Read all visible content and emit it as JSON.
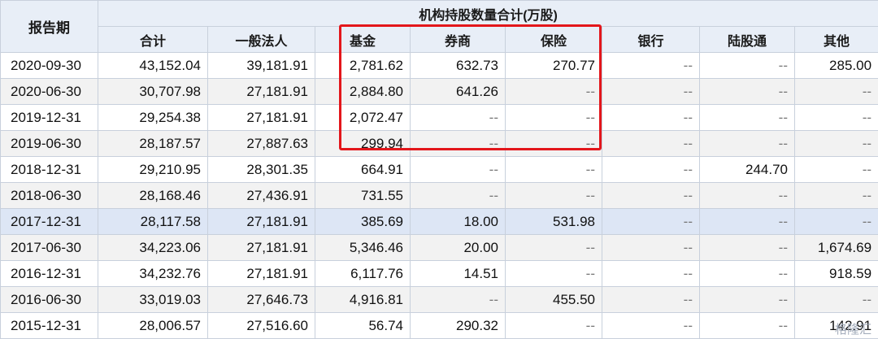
{
  "header": {
    "date_col": "报告期",
    "group_title": "机构持股数量合计(万股)",
    "columns": [
      "合计",
      "一般法人",
      "基金",
      "券商",
      "保险",
      "银行",
      "陆股通",
      "其他"
    ]
  },
  "rows": [
    {
      "date": "2020-09-30",
      "cells": [
        "43,152.04",
        "39,181.91",
        "2,781.62",
        "632.73",
        "270.77",
        "--",
        "--",
        "285.00"
      ]
    },
    {
      "date": "2020-06-30",
      "cells": [
        "30,707.98",
        "27,181.91",
        "2,884.80",
        "641.26",
        "--",
        "--",
        "--",
        "--"
      ]
    },
    {
      "date": "2019-12-31",
      "cells": [
        "29,254.38",
        "27,181.91",
        "2,072.47",
        "--",
        "--",
        "--",
        "--",
        "--"
      ]
    },
    {
      "date": "2019-06-30",
      "cells": [
        "28,187.57",
        "27,887.63",
        "299.94",
        "--",
        "--",
        "--",
        "--",
        "--"
      ]
    },
    {
      "date": "2018-12-31",
      "cells": [
        "29,210.95",
        "28,301.35",
        "664.91",
        "--",
        "--",
        "--",
        "244.70",
        "--"
      ]
    },
    {
      "date": "2018-06-30",
      "cells": [
        "28,168.46",
        "27,436.91",
        "731.55",
        "--",
        "--",
        "--",
        "--",
        "--"
      ]
    },
    {
      "date": "2017-12-31",
      "cells": [
        "28,117.58",
        "27,181.91",
        "385.69",
        "18.00",
        "531.98",
        "--",
        "--",
        "--"
      ]
    },
    {
      "date": "2017-06-30",
      "cells": [
        "34,223.06",
        "27,181.91",
        "5,346.46",
        "20.00",
        "--",
        "--",
        "--",
        "1,674.69"
      ]
    },
    {
      "date": "2016-12-31",
      "cells": [
        "34,232.76",
        "27,181.91",
        "6,117.76",
        "14.51",
        "--",
        "--",
        "--",
        "918.59"
      ]
    },
    {
      "date": "2016-06-30",
      "cells": [
        "33,019.03",
        "27,646.73",
        "4,916.81",
        "--",
        "455.50",
        "--",
        "--",
        "--"
      ]
    },
    {
      "date": "2015-12-31",
      "cells": [
        "28,006.57",
        "27,516.60",
        "56.74",
        "290.32",
        "--",
        "--",
        "--",
        "142.91"
      ]
    }
  ],
  "watermark": "格隆汇",
  "colors": {
    "highlight_box": "#e3161b",
    "header_bg": "#e8eef7",
    "highlight_row": "#dde6f5"
  }
}
